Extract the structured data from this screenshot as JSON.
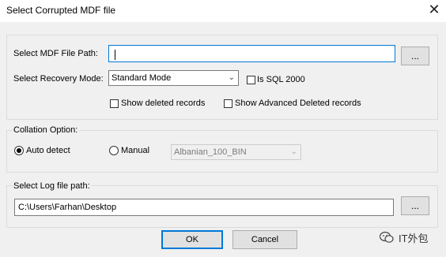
{
  "window": {
    "title": "Select Corrupted MDF file",
    "close_glyph": "✕"
  },
  "mdf_group": {
    "path_label": "Select MDF File Path:",
    "path_value": "",
    "browse_label": "...",
    "recovery_label": "Select Recovery Mode:",
    "recovery_selected": "Standard Mode",
    "sql2000_label": "Is SQL 2000",
    "sql2000_checked": false,
    "show_deleted_label": "Show deleted records",
    "show_deleted_checked": false,
    "show_adv_deleted_label": "Show Advanced Deleted records",
    "show_adv_deleted_checked": false
  },
  "collation_group": {
    "title": "Collation Option:",
    "auto_label": "Auto detect",
    "manual_label": "Manual",
    "selected_option": "auto",
    "collation_value": "Albanian_100_BIN"
  },
  "log_group": {
    "title": "Select Log file path:",
    "path_value": "C:\\Users\\Farhan\\Desktop",
    "browse_label": "..."
  },
  "buttons": {
    "ok_label": "OK",
    "cancel_label": "Cancel"
  },
  "watermark": {
    "text": "IT外包",
    "icon": "wechat-icon"
  },
  "icons": {
    "dropdown": "chevron-down-icon",
    "close": "close-icon"
  }
}
